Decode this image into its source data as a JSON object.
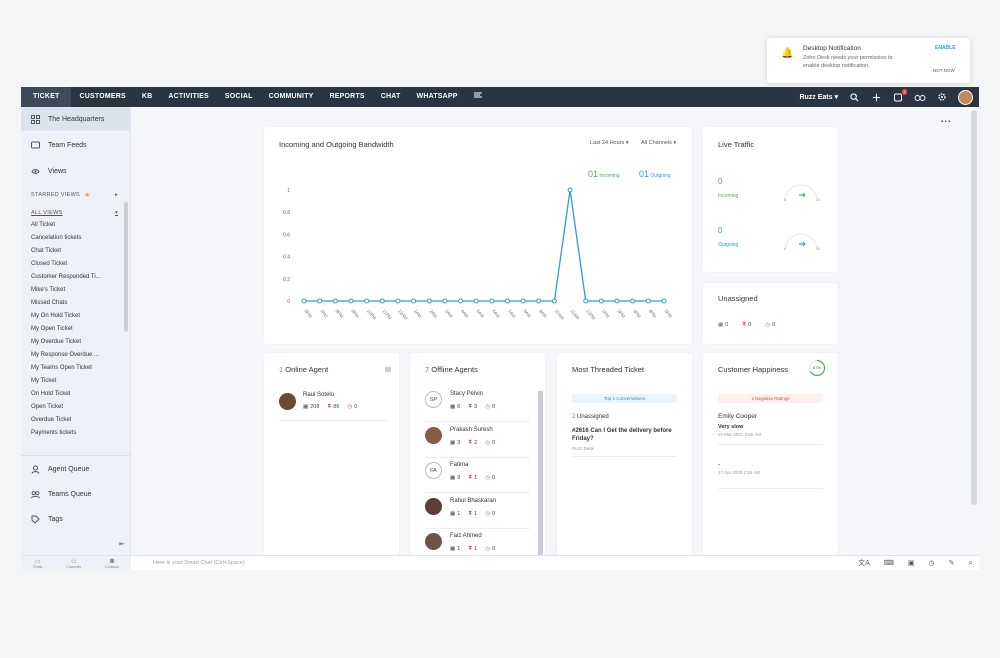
{
  "nav": {
    "tabs": [
      "TICKET",
      "CUSTOMERS",
      "KB",
      "ACTIVITIES",
      "SOCIAL",
      "COMMUNITY",
      "REPORTS",
      "CHAT",
      "WHATSAPP"
    ],
    "brand": "Ruzz Eats",
    "notification_count": "1",
    "more": "..."
  },
  "sidebar": {
    "top_items": [
      {
        "label": "The Headquarters",
        "icon": "grid-icon"
      },
      {
        "label": "Team Feeds",
        "icon": "feed-icon"
      },
      {
        "label": "Views",
        "icon": "views-icon"
      }
    ],
    "starred_label": "STARRED VIEWS",
    "all_views_label": "ALL VIEWS",
    "views": [
      "All Ticket",
      "Cancelation tickets",
      "Chat Ticket",
      "Closed Ticket",
      "Customer Responded Ti...",
      "Mike's Ticket",
      "Missed Chats",
      "My On Hold Ticket",
      "My Open Ticket",
      "My Overdue Ticket",
      "My Response Overdue ...",
      "My Teams Open Ticket",
      "My Ticket",
      "On Hold Ticket",
      "Open Ticket",
      "Overdue Ticket",
      "Payments tickets"
    ],
    "bottom_items": [
      {
        "label": "Agent Queue",
        "icon": "agent-queue-icon"
      },
      {
        "label": "Teams Queue",
        "icon": "teams-queue-icon"
      },
      {
        "label": "Tags",
        "icon": "tags-icon"
      }
    ],
    "collapse": "⇤"
  },
  "bottombar": {
    "left": [
      "Chats",
      "Channels",
      "Contacts"
    ],
    "chat_placeholder": "Here is your Smart Chat (Ctrl+Space)",
    "zoom": "⌕"
  },
  "bandwidth": {
    "title": "Incoming and Outgoing Bandwidth",
    "range": "Last 24 Hours",
    "channel": "All Channels",
    "incoming_count": "01",
    "incoming_label": "Incoming",
    "outgoing_count": "01",
    "outgoing_label": "Outgoing",
    "colors": {
      "incoming": "#4caf50",
      "outgoing": "#2a9fd6"
    }
  },
  "chart_data": {
    "type": "line",
    "x": [
      "6PM",
      "7PM",
      "8PM",
      "9PM",
      "10PM",
      "11PM",
      "12AM",
      "1AM",
      "2AM",
      "3AM",
      "4AM",
      "5AM",
      "6AM",
      "7AM",
      "8AM",
      "9AM",
      "10AM",
      "11AM",
      "12PM",
      "1PM",
      "2PM",
      "3PM",
      "4PM",
      "5PM"
    ],
    "series": [
      {
        "name": "Outgoing",
        "values": [
          0,
          0,
          0,
          0,
          0,
          0,
          0,
          0,
          0,
          0,
          0,
          0,
          0,
          0,
          0,
          0,
          0,
          1,
          0,
          0,
          0,
          0,
          0,
          0
        ]
      }
    ],
    "yticks": [
      "0",
      "0.2",
      "0.4",
      "0.6",
      "0.8",
      "1"
    ],
    "ylim": [
      0,
      1
    ],
    "grid": false
  },
  "live_traffic": {
    "title": "Live Traffic",
    "incoming_value": "0",
    "incoming_label": "Incoming",
    "outgoing_value": "0",
    "outgoing_label": "Outgoing",
    "gauge_min": "0",
    "gauge_max": "10"
  },
  "unassigned": {
    "title": "Unassigned",
    "stats": [
      "0",
      "0",
      "0"
    ]
  },
  "online_agent": {
    "count": "1",
    "title": "Online Agent",
    "agents": [
      {
        "name": "Raul Sotelo",
        "a": "208",
        "b": "86",
        "c": "0"
      }
    ]
  },
  "offline_agents": {
    "count": "7",
    "title": "Offline Agents",
    "agents": [
      {
        "name": "Stacy Pelvin",
        "initials": "SP",
        "a": "6",
        "b": "3",
        "c": "0"
      },
      {
        "name": "Prakash Suresh",
        "initials": "",
        "a": "3",
        "b": "2",
        "c": "0"
      },
      {
        "name": "Fatima",
        "initials": "FA",
        "a": "9",
        "b": "1",
        "c": "0"
      },
      {
        "name": "Rahul Bhaskaran",
        "initials": "",
        "a": "1",
        "b": "1",
        "c": "0"
      },
      {
        "name": "Faiz Ahmed",
        "initials": "",
        "a": "1",
        "b": "1",
        "c": "0"
      }
    ]
  },
  "threaded": {
    "title": "Most Threaded Ticket",
    "pill": "Top 1 Conversations",
    "count": "2",
    "status": "Unassigned",
    "ticket": "#2616 Can I Get the delivery before Friday?",
    "dept": "Ruzz Desk"
  },
  "happiness": {
    "title": "Customer Happiness",
    "percent": "67%",
    "pill": "2 Negative Ratings",
    "entries": [
      {
        "name": "Emily Cooper",
        "rating": "Very slow",
        "date": "03 Mar 2021 4:55 AM"
      },
      {
        "name": "-",
        "rating": "",
        "date": "17 Apr 2020 1:55 AM"
      }
    ]
  },
  "notification": {
    "title": "Desktop Notification",
    "body": "Zoho Desk needs your permission to enable desktop notification.",
    "enable": "ENABLE",
    "not_now": "NOT NOW"
  }
}
